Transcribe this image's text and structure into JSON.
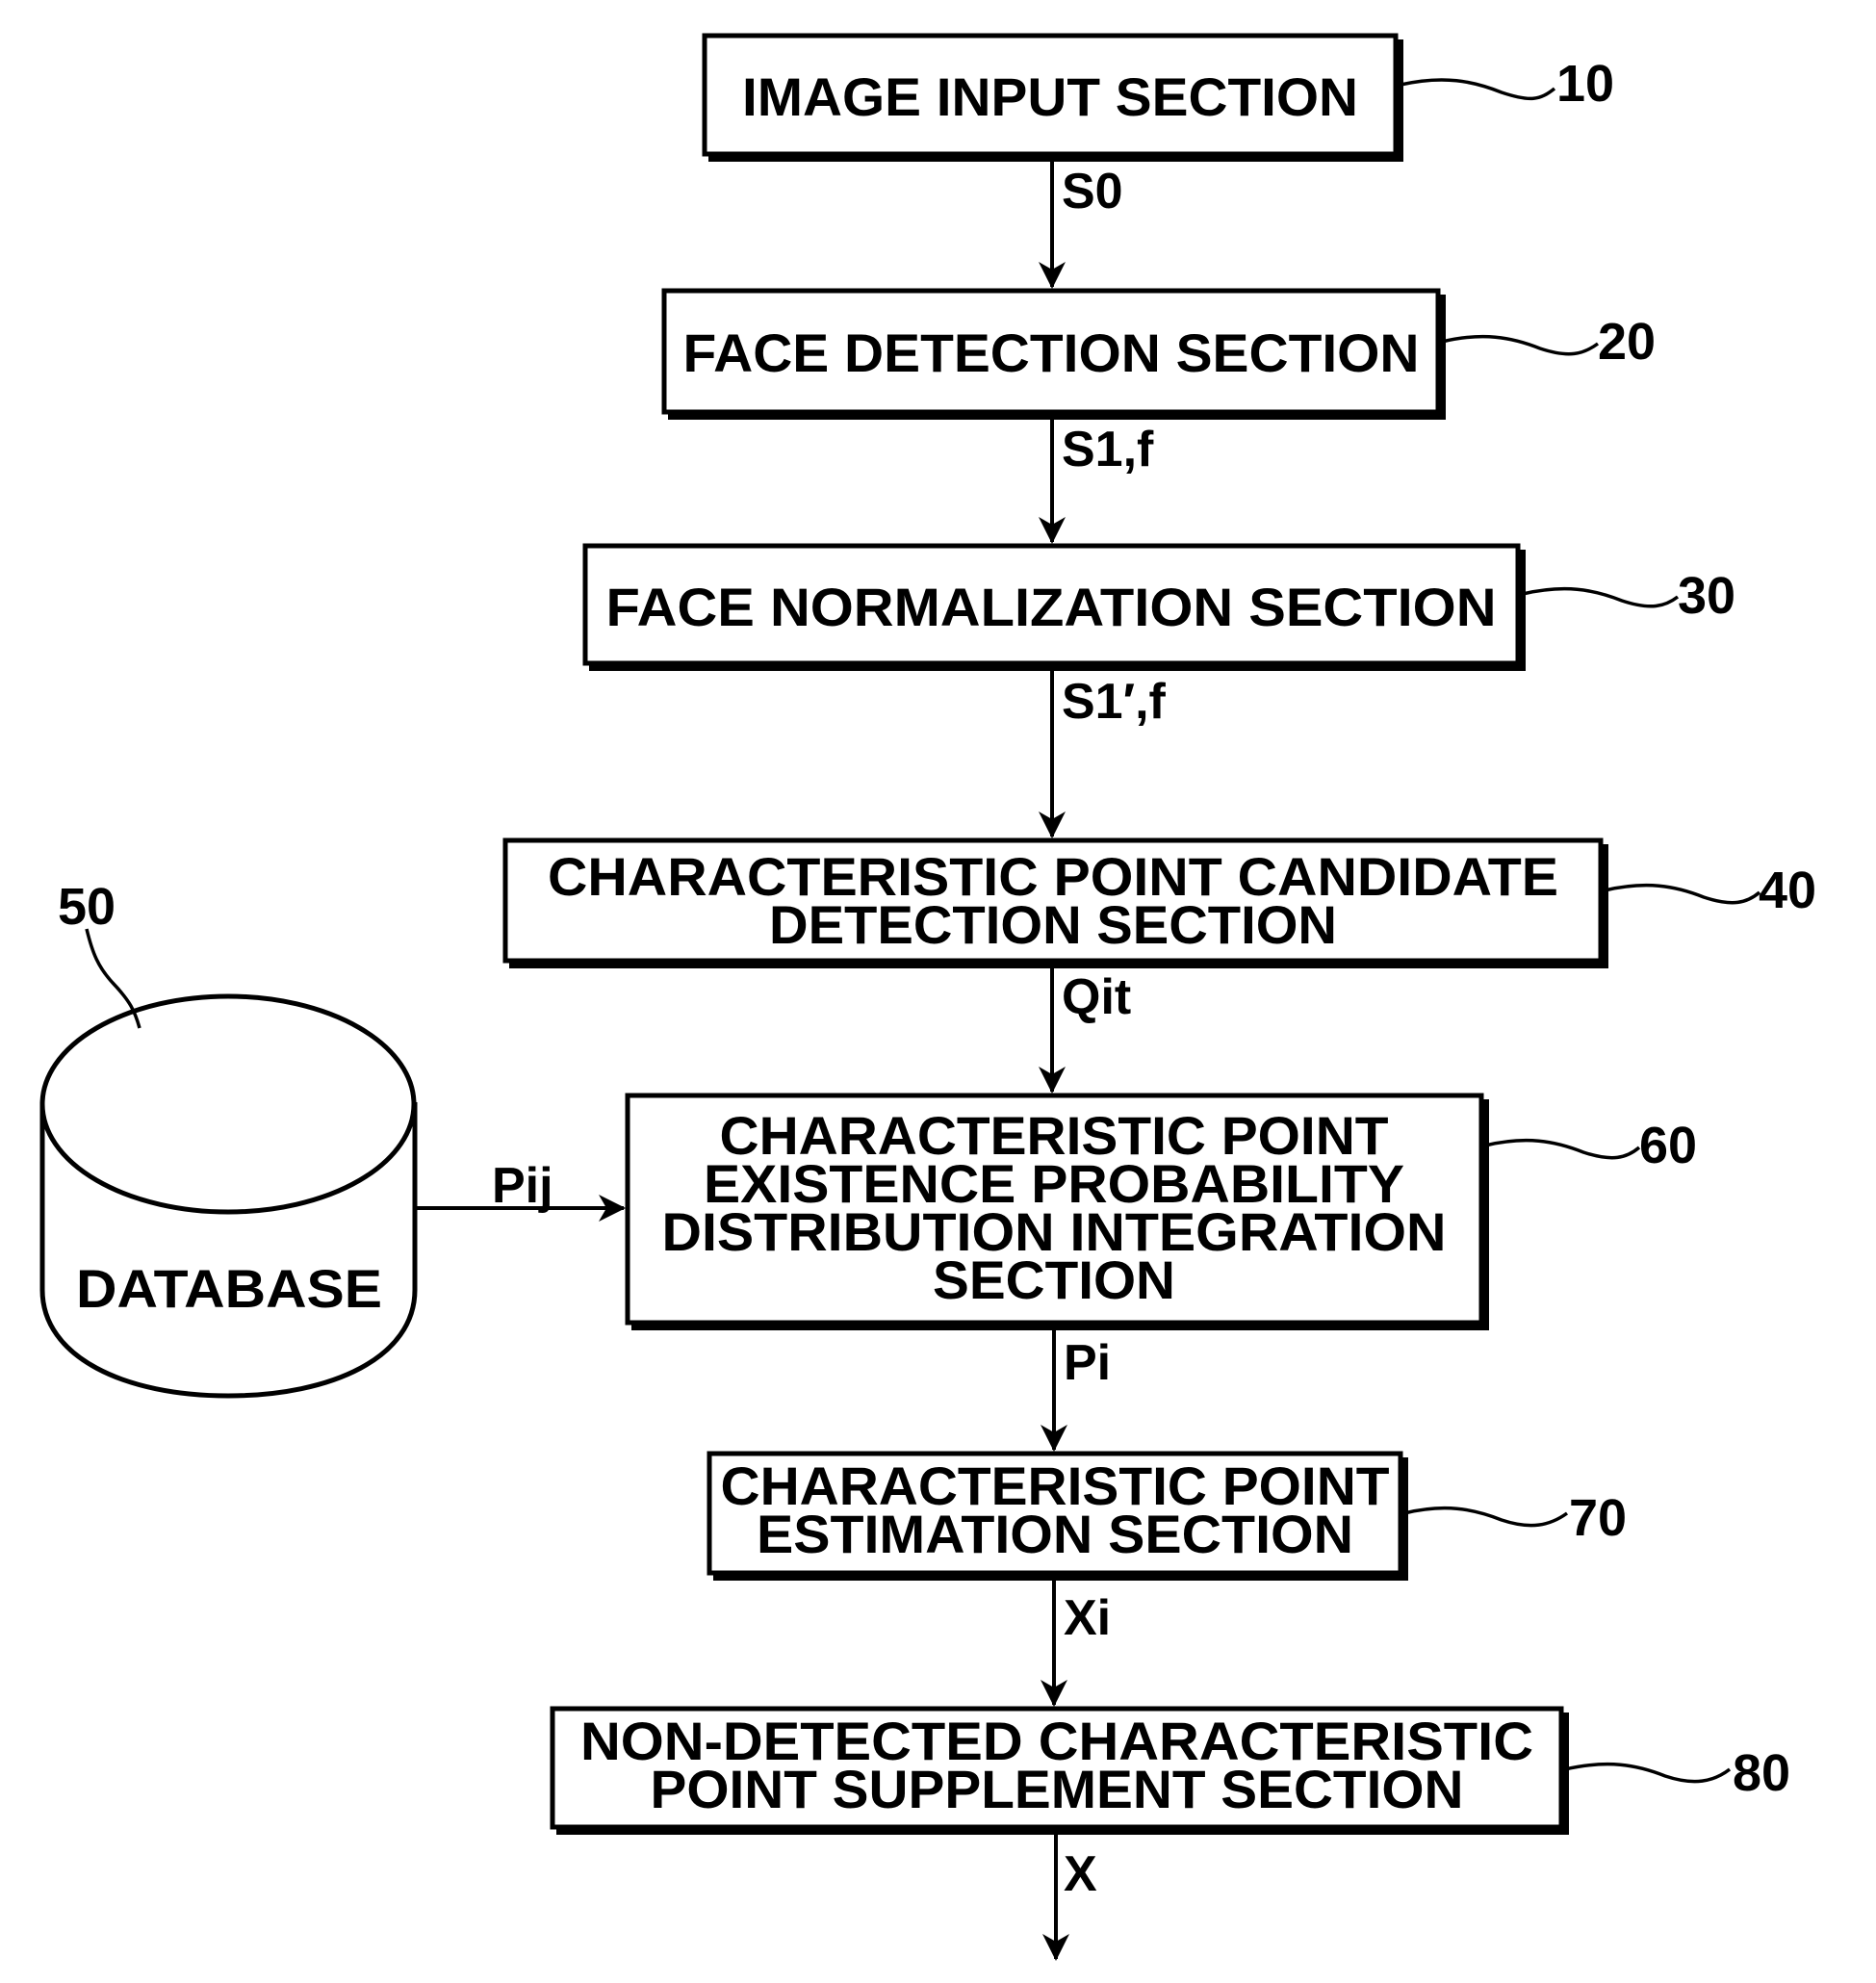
{
  "figure": {
    "blocks": [
      {
        "id": "image-input",
        "ref": "10",
        "lines": [
          "IMAGE INPUT SECTION"
        ]
      },
      {
        "id": "face-detection",
        "ref": "20",
        "lines": [
          "FACE DETECTION SECTION"
        ]
      },
      {
        "id": "face-normalization",
        "ref": "30",
        "lines": [
          "FACE NORMALIZATION SECTION"
        ]
      },
      {
        "id": "candidate-detection",
        "ref": "40",
        "lines": [
          "CHARACTERISTIC POINT CANDIDATE",
          "DETECTION SECTION"
        ]
      },
      {
        "id": "probability-integration",
        "ref": "60",
        "lines": [
          "CHARACTERISTIC POINT",
          "EXISTENCE PROBABILITY",
          "DISTRIBUTION INTEGRATION",
          "SECTION"
        ]
      },
      {
        "id": "point-estimation",
        "ref": "70",
        "lines": [
          "CHARACTERISTIC POINT",
          "ESTIMATION SECTION"
        ]
      },
      {
        "id": "point-supplement",
        "ref": "80",
        "lines": [
          "NON-DETECTED CHARACTERISTIC",
          "POINT SUPPLEMENT SECTION"
        ]
      }
    ],
    "database": {
      "ref": "50",
      "label": "DATABASE"
    },
    "signals": [
      {
        "from": "image-input",
        "to": "face-detection",
        "label": "S0"
      },
      {
        "from": "face-detection",
        "to": "face-normalization",
        "label": "S1,f"
      },
      {
        "from": "face-normalization",
        "to": "candidate-detection",
        "label": "S1′,f"
      },
      {
        "from": "candidate-detection",
        "to": "probability-integration",
        "label": "Qit"
      },
      {
        "from": "database",
        "to": "probability-integration",
        "label": "Pij"
      },
      {
        "from": "probability-integration",
        "to": "point-estimation",
        "label": "Pi"
      },
      {
        "from": "point-estimation",
        "to": "point-supplement",
        "label": "Xi"
      },
      {
        "from": "point-supplement",
        "to": "output",
        "label": "X"
      }
    ]
  }
}
